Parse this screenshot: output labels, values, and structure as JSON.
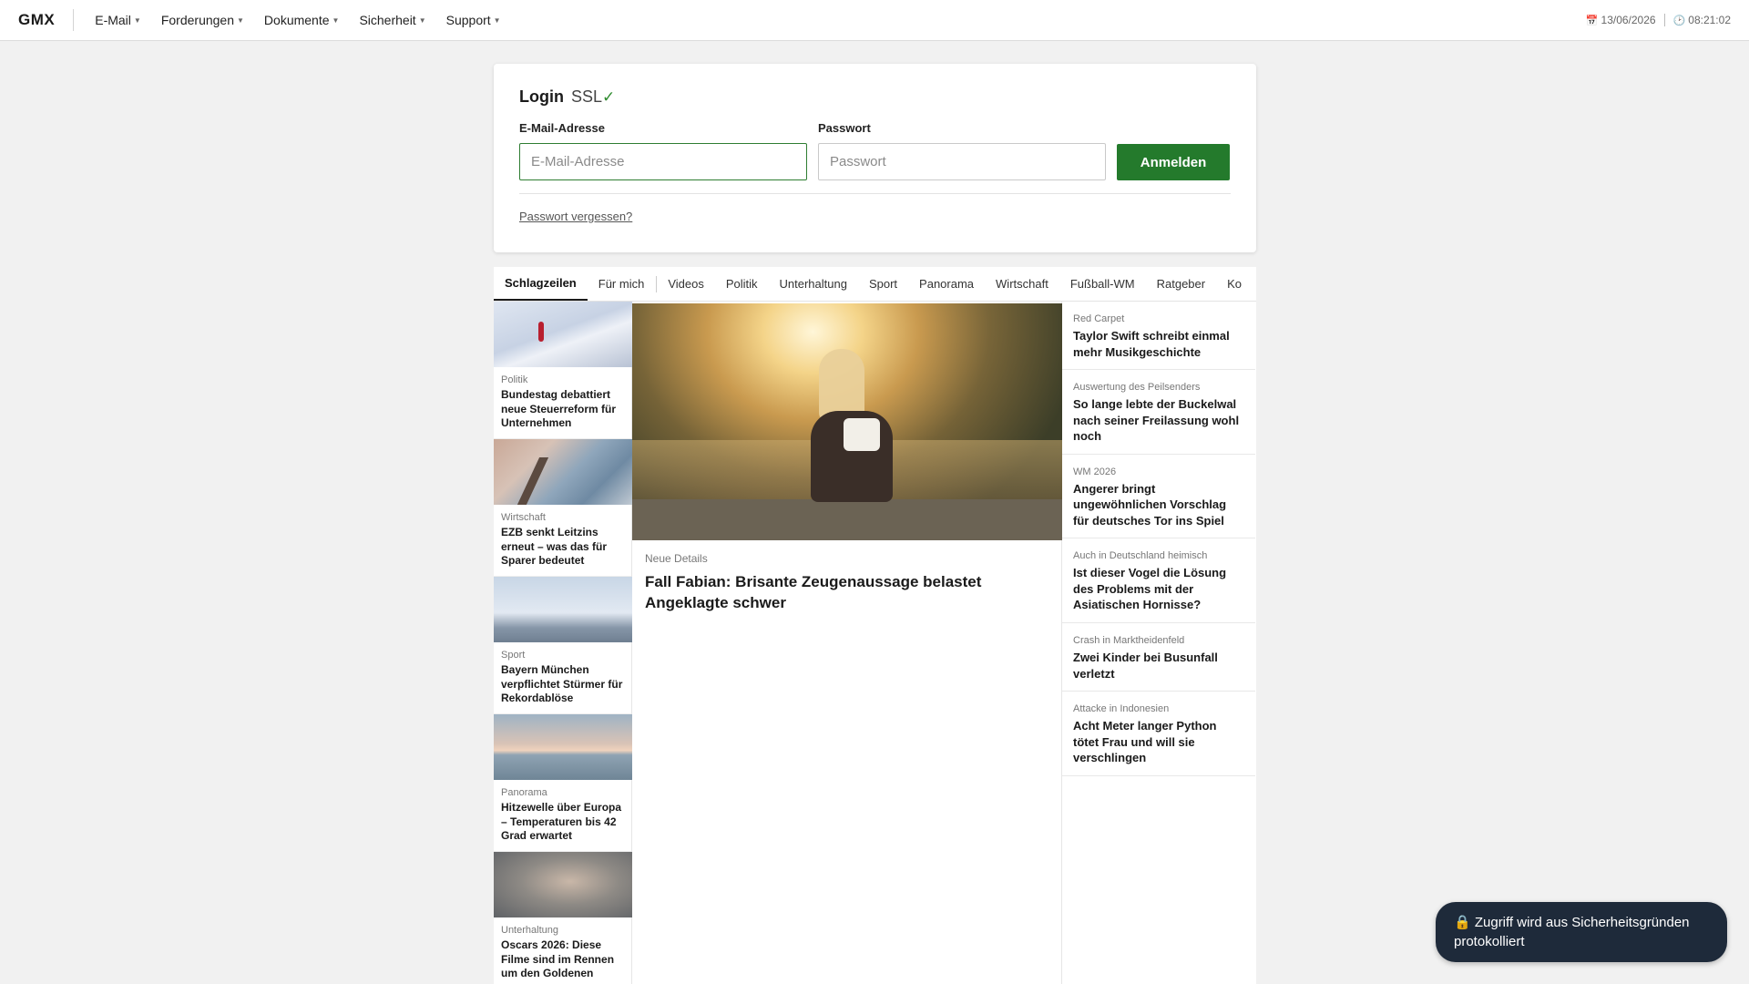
{
  "header": {
    "logo": "GMX",
    "nav": [
      {
        "label": "E-Mail"
      },
      {
        "label": "Forderungen"
      },
      {
        "label": "Dokumente"
      },
      {
        "label": "Sicherheit"
      },
      {
        "label": "Support"
      }
    ],
    "date": "13/06/2026",
    "time": "08:21:02"
  },
  "login": {
    "title": "Login",
    "ssl": "SSL",
    "ssl_check": "✓",
    "email_label": "E-Mail-Adresse",
    "email_placeholder": "E-Mail-Adresse",
    "email_value": "",
    "password_label": "Passwort",
    "password_placeholder": "Passwort",
    "password_value": "",
    "submit_label": "Anmelden",
    "forgot_label": "Passwort vergessen?",
    "accent_color": "#247a2c"
  },
  "tabs": [
    {
      "label": "Schlagzeilen",
      "active": true
    },
    {
      "label": "Für mich"
    },
    {
      "label": "Videos"
    },
    {
      "label": "Politik"
    },
    {
      "label": "Unterhaltung"
    },
    {
      "label": "Sport"
    },
    {
      "label": "Panorama"
    },
    {
      "label": "Wirtschaft"
    },
    {
      "label": "Fußball-WM"
    },
    {
      "label": "Ratgeber"
    },
    {
      "label": "Ko"
    }
  ],
  "left_teasers": [
    {
      "category": "Politik",
      "title": "Bundestag debattiert neue Steuerreform für Unternehmen"
    },
    {
      "category": "Wirtschaft",
      "title": "EZB senkt Leitzins erneut – was das für Sparer bedeutet"
    },
    {
      "category": "Sport",
      "title": "Bayern München verpflichtet Stürmer für Rekordablöse"
    },
    {
      "category": "Panorama",
      "title": "Hitzewelle über Europa – Temperaturen bis 42 Grad erwartet"
    },
    {
      "category": "Unterhaltung",
      "title": "Oscars 2026: Diese Filme sind im Rennen um den Goldenen"
    }
  ],
  "hero": {
    "category": "Neue Details",
    "title": "Fall Fabian: Brisante Zeugenaussage belastet Angeklagte schwer"
  },
  "right_news": [
    {
      "category": "Red Carpet",
      "title": "Taylor Swift schreibt einmal mehr Musikgeschichte"
    },
    {
      "category": "Auswertung des Peilsenders",
      "title": "So lange lebte der Buckelwal nach seiner Freilassung wohl noch"
    },
    {
      "category": "WM 2026",
      "title": "Angerer bringt ungewöhnlichen Vorschlag für deutsches Tor ins Spiel"
    },
    {
      "category": "Auch in Deutschland heimisch",
      "title": "Ist dieser Vogel die Lösung des Problems mit der Asiatischen Hornisse?"
    },
    {
      "category": "Crash in Marktheidenfeld",
      "title": "Zwei Kinder bei Busunfall verletzt"
    },
    {
      "category": "Attacke in Indonesien",
      "title": "Acht Meter langer Python tötet Frau und will sie verschlingen"
    }
  ],
  "toast": {
    "icon": "lock-icon",
    "text": "🔒 Zugriff wird aus Sicherheitsgründen protokolliert"
  }
}
